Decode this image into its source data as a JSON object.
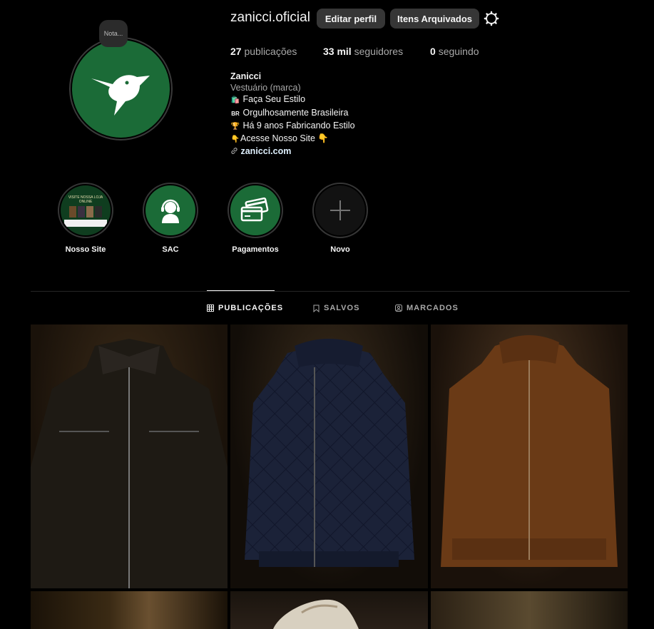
{
  "profile": {
    "username": "zanicci.oficial",
    "note": "Nota...",
    "edit_button": "Editar perfil",
    "archive_button": "Itens Arquivados",
    "settings_icon": "gear-icon"
  },
  "stats": {
    "posts_count": "27",
    "posts_label": "publicações",
    "followers_count": "33 mil",
    "followers_label": "seguidores",
    "following_count": "0",
    "following_label": "seguindo"
  },
  "bio": {
    "name": "Zanicci",
    "category": "Vestuário (marca)",
    "lines": [
      {
        "icon": "🛍️",
        "text": "Faça Seu Estilo"
      },
      {
        "icon": "BR",
        "text": "Orgulhosamente Brasileira"
      },
      {
        "icon": "🏆",
        "text": "Há 9 anos Fabricando Estilo"
      },
      {
        "icon": "👇",
        "text": "Acesse Nosso Site 👇"
      }
    ],
    "link_icon": "link-icon",
    "link": "zanicci.com"
  },
  "highlights": [
    {
      "label": "Nosso Site",
      "thumb_text": "VISITE NOSSA LOJA ONLINE"
    },
    {
      "label": "SAC"
    },
    {
      "label": "Pagamentos"
    },
    {
      "label": "Novo"
    }
  ],
  "tabs": [
    {
      "label": "PUBLICAÇÕES",
      "icon": "grid-icon",
      "active": true
    },
    {
      "label": "SALVOS",
      "icon": "bookmark-icon",
      "active": false
    },
    {
      "label": "MARCADOS",
      "icon": "tagged-icon",
      "active": false
    }
  ],
  "colors": {
    "background": "#000000",
    "brand_green": "#1b6b37",
    "button_bg": "#363636",
    "muted_text": "#a8a8a8"
  }
}
